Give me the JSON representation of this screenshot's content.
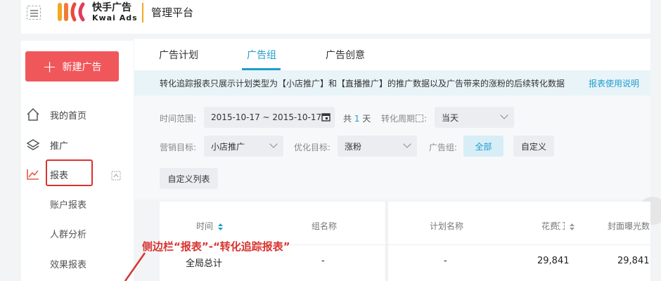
{
  "header": {
    "logo_cn": "快手广告",
    "logo_en": "Kwai Ads",
    "platform_title": "管理平台"
  },
  "sidebar": {
    "new_ad_label": "新建广告",
    "items": [
      {
        "label": "我的首页",
        "icon": "home-icon"
      },
      {
        "label": "推广",
        "icon": "layers-icon"
      },
      {
        "label": "报表",
        "icon": "trend-chart-icon"
      }
    ],
    "sub_items": [
      "账户报表",
      "人群分析",
      "效果报表"
    ]
  },
  "tabs": [
    "广告计划",
    "广告组",
    "广告创意"
  ],
  "active_tab": "广告组",
  "notice": {
    "text": "转化追踪报表只展示计划类型为【小店推广】和【直播推广】的推广数据以及广告带来的涨粉的后续转化数据",
    "link": "报表使用说明"
  },
  "filters": {
    "time_range_label": "时间范围:",
    "time_range_value": "2015-10-17 ~ 2015-10-17",
    "total_prefix": "共",
    "total_days": "1",
    "total_suffix": "天",
    "conversion_period_label": "转化周期",
    "conversion_period_value": "当天",
    "marketing_goal_label": "营销目标:",
    "marketing_goal_value": "小店推广",
    "optimize_goal_label": "优化目标:",
    "optimize_goal_value": "涨粉",
    "ad_group_label": "广告组:",
    "ad_group_all": "全部",
    "ad_group_custom": "自定义",
    "custom_columns_button": "自定义列表"
  },
  "table": {
    "headers": [
      "时间",
      "组名称",
      "计划名称",
      "花费",
      "封面曝光数"
    ],
    "total_row": [
      "全局总计",
      "-",
      "-",
      "29,841",
      "29,841"
    ]
  },
  "annotation": "侧边栏“报表”-“转化追踪报表”",
  "colors": {
    "accent": "#1f9ccf",
    "new_ad_button": "#f0575b",
    "annotation_red": "#d9332f"
  }
}
